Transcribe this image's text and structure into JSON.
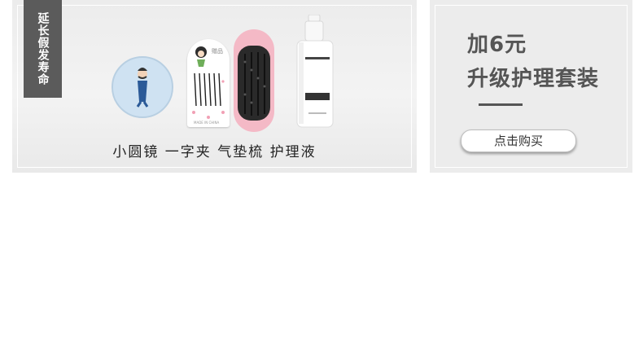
{
  "left_panel": {
    "tag_text": "延长假发寿命",
    "caption": "小圆镜 一字夹 气垫梳 护理液",
    "pins_card_title": "赠品",
    "pins_card_foot": "MADE IN CHINA"
  },
  "right_panel": {
    "heading_line1": "加6元",
    "heading_line2": "升级护理套装",
    "buy_label": "点击购买"
  }
}
